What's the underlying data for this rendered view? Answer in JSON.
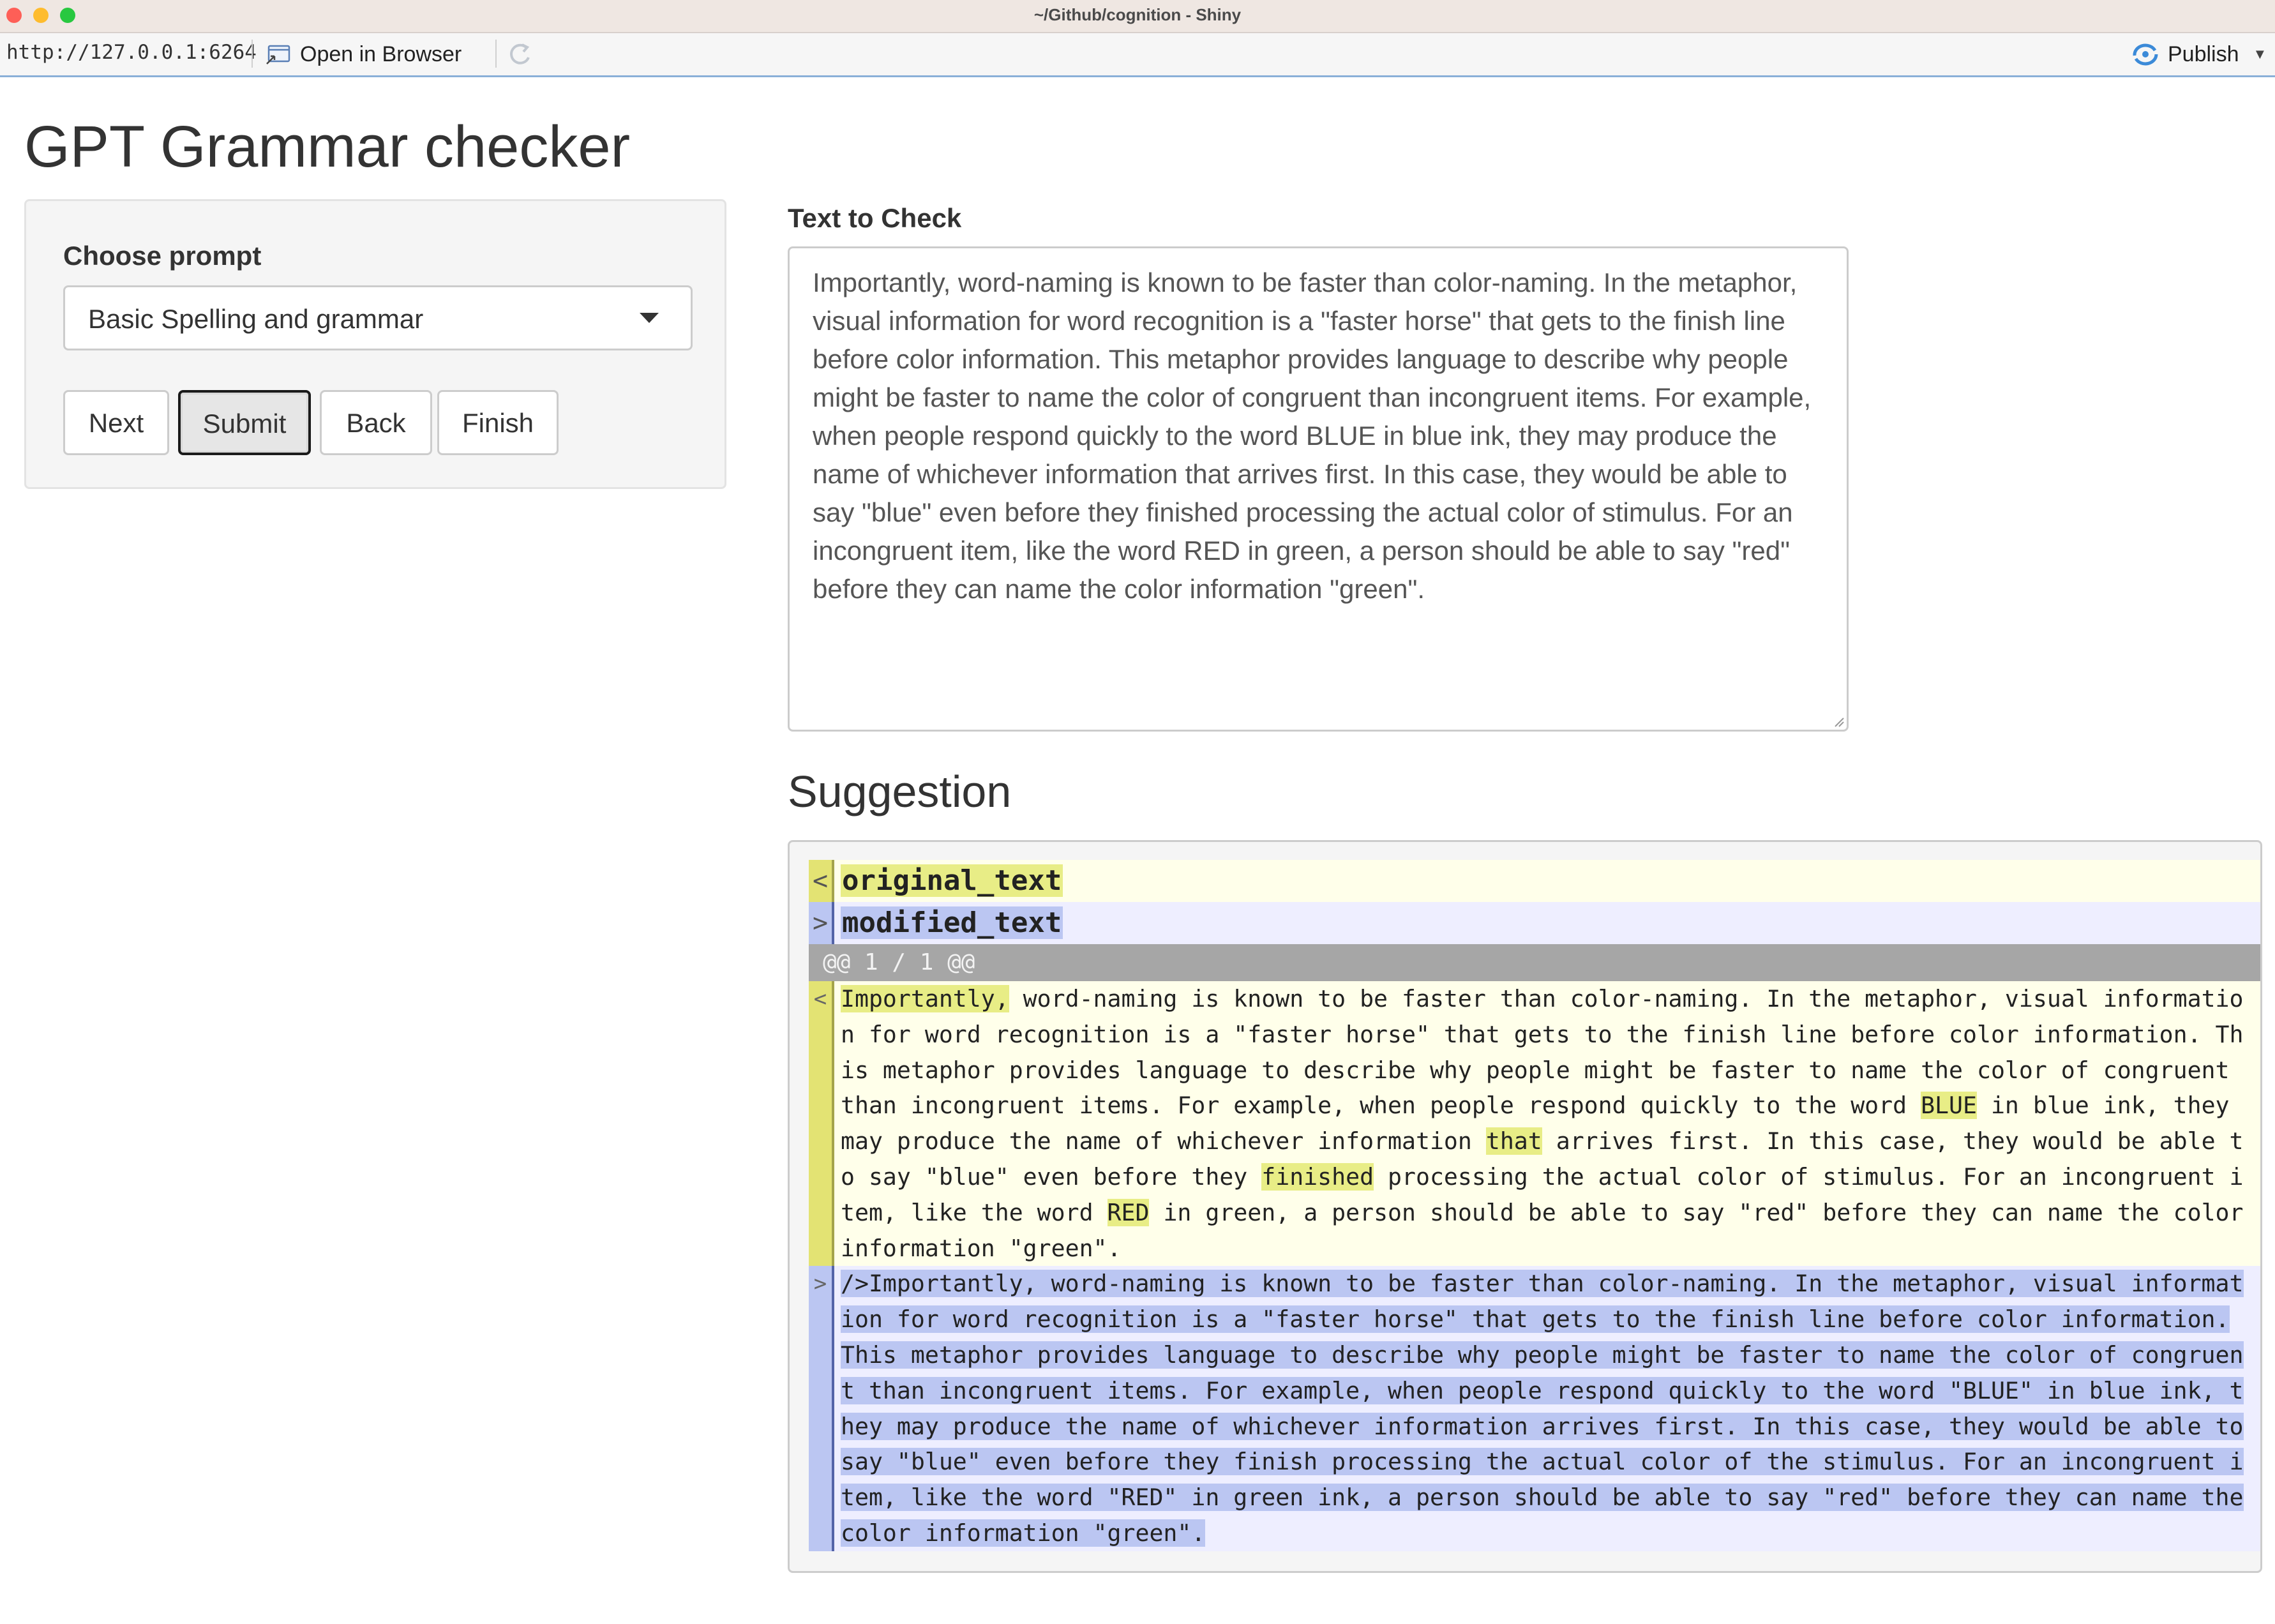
{
  "window": {
    "title": "~/Github/cognition - Shiny"
  },
  "toolbar": {
    "url": "http://127.0.0.1:6264",
    "open_in_browser": "Open in Browser",
    "publish": "Publish"
  },
  "app": {
    "title": "GPT Grammar checker"
  },
  "sidebar": {
    "prompt_label": "Choose prompt",
    "prompt_value": "Basic Spelling and grammar",
    "buttons": {
      "next": "Next",
      "submit": "Submit",
      "back": "Back",
      "finish": "Finish"
    }
  },
  "main": {
    "text_label": "Text to Check",
    "text_value": "Importantly, word-naming is known to be faster than color-naming. In the metaphor, visual information for word recognition is a \"faster horse\" that gets to the finish line before color information. This metaphor provides language to describe why people might be faster to name the color of congruent than incongruent items. For example, when people respond quickly to the word BLUE in blue ink, they may produce the name of whichever information that arrives first. In this case, they would be able to say \"blue\" even before they finished processing the actual color of stimulus. For an incongruent item, like the word RED in green, a person should be able to say \"red\" before they can name the color information \"green\".",
    "suggestion_title": "Suggestion"
  },
  "diff": {
    "original_marker": "<",
    "modified_marker": ">",
    "original_label": "original_text",
    "modified_label": "modified_text",
    "hunk_header": "@@ 1 / 1 @@",
    "old_segments": [
      {
        "t": "Importantly,",
        "hl": true
      },
      {
        "t": " word-naming is known to be faster than color-naming. In the metaphor, visual information for word recognition is a \"faster horse\" that gets to the finish line before color information. This metaphor provides language to describe why people might be faster to name the color of congruent than incongruent items. For example, when people respond quickly to the word ",
        "hl": false
      },
      {
        "t": "BLUE",
        "hl": true
      },
      {
        "t": " in blue ink, they may produce the name of whichever information ",
        "hl": false
      },
      {
        "t": "that",
        "hl": true
      },
      {
        "t": " arrives first. In this case, they would be able to say \"blue\" even before they ",
        "hl": false
      },
      {
        "t": "finished",
        "hl": true
      },
      {
        "t": " processing the actual color of stimulus. For an incongruent item, like the word ",
        "hl": false
      },
      {
        "t": "RED",
        "hl": true
      },
      {
        "t": " in green, a person should be able to say \"red\" before they can name the color information \"green\".",
        "hl": false
      }
    ],
    "new_text": " />Importantly, word-naming is known to be faster than color-naming. In the metaphor, visual information for word recognition is a \"faster horse\" that gets to the finish line before color information. This metaphor provides language to describe why people might be faster to name the color of congruent than incongruent items. For example, when people respond quickly to the word \"BLUE\" in blue ink, they may produce the name of whichever information arrives first. In this case, they would be able to say \"blue\" even before they finish processing the actual color of the stimulus. For an incongruent item, like the word \"RED\" in green ink, a person should be able to say \"red\" before they can name the color information \"green\"."
  },
  "icons": {
    "open_in_browser": "browser-window-icon",
    "refresh": "refresh-icon",
    "publish": "publish-icon",
    "dropdown": "caret-down-icon"
  },
  "colors": {
    "old_bg": "#ffffea",
    "old_gutter": "#e3e373",
    "old_highlight": "#e8ed86",
    "new_bg": "#eeeeff",
    "new_gutter": "#bbc6f2",
    "hunk_bg": "#a6a6a6",
    "publish_accent": "#3b8ad8"
  }
}
